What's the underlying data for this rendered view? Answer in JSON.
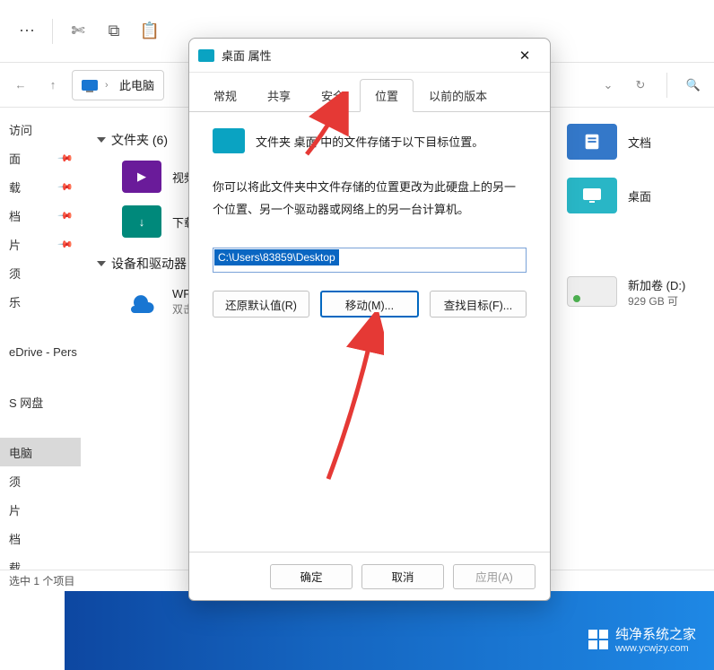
{
  "toolbar": {
    "cut_icon": "cut-icon",
    "copy_icon": "copy-icon",
    "paste_icon": "paste-icon"
  },
  "nav": {
    "address_label": "此电脑"
  },
  "sidebar": {
    "items": [
      {
        "label": "访问"
      },
      {
        "label": "面"
      },
      {
        "label": "载"
      },
      {
        "label": "档"
      },
      {
        "label": "片"
      },
      {
        "label": "须"
      },
      {
        "label": "乐"
      },
      {
        "label": "eDrive - Pers"
      },
      {
        "label": "S 网盘"
      },
      {
        "label": "电脑"
      },
      {
        "label": "须"
      },
      {
        "label": "片"
      },
      {
        "label": "档"
      },
      {
        "label": "载"
      }
    ]
  },
  "content": {
    "folders_header": "文件夹 (6)",
    "folder_items": [
      {
        "label": "视频"
      },
      {
        "label": "下载"
      }
    ],
    "devices_header": "设备和驱动器",
    "wps_label": "WPS网",
    "wps_sub": "双击进"
  },
  "right": {
    "docs_label": "文档",
    "desktop_label": "桌面",
    "drive_label": "新加卷 (D:)",
    "drive_sub": "929 GB 可"
  },
  "status": {
    "text": "选中 1 个项目"
  },
  "dialog": {
    "title": "桌面 属性",
    "tabs": {
      "general": "常规",
      "share": "共享",
      "security": "安全",
      "location": "位置",
      "prev": "以前的版本"
    },
    "header": "文件夹 桌面  中的文件存储于以下目标位置。",
    "desc": "你可以将此文件夹中文件存储的位置更改为此硬盘上的另一个位置、另一个驱动器或网络上的另一台计算机。",
    "path": "C:\\Users\\83859\\Desktop",
    "buttons": {
      "restore": "还原默认值(R)",
      "move": "移动(M)...",
      "find": "查找目标(F)..."
    },
    "footer": {
      "ok": "确定",
      "cancel": "取消",
      "apply": "应用(A)"
    }
  },
  "watermark": {
    "line1": "纯净系统之家",
    "line2": "www.ycwjzy.com"
  }
}
